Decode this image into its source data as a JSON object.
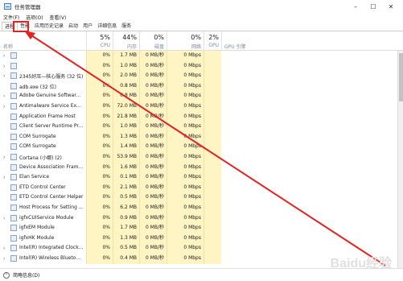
{
  "window": {
    "title": "任务管理器",
    "min": "–",
    "max": "☐",
    "close": "✕"
  },
  "menu": [
    "文件(F)",
    "选项(O)",
    "查看(V)"
  ],
  "tabs": [
    "进程",
    "性能",
    "应用历史记录",
    "启动",
    "用户",
    "详细信息",
    "服务"
  ],
  "columns": {
    "name": "名称",
    "cpu": {
      "pct": "5%",
      "label": "CPU"
    },
    "mem": {
      "pct": "44%",
      "label": "内存"
    },
    "disk": {
      "pct": "0%",
      "label": "磁盘"
    },
    "net": {
      "pct": "0%",
      "label": "网络"
    },
    "gpu": {
      "pct": "2%",
      "label": "GPU"
    },
    "gpu_engine": {
      "label": "GPU 引擎"
    }
  },
  "rows": [
    {
      "name": "",
      "cpu": "0%",
      "mem": "1.7 MB",
      "disk": "0 MB/秒",
      "net": "0 Mbps",
      "expand": true
    },
    {
      "name": "",
      "cpu": "0%",
      "mem": "1.0 MB",
      "disk": "0 MB/秒",
      "net": "0 Mbps",
      "expand": true
    },
    {
      "name": "2345好压—核心服务 (32 位)",
      "cpu": "0%",
      "mem": "2.0 MB",
      "disk": "0 MB/秒",
      "net": "0 Mbps",
      "expand": true
    },
    {
      "name": "adb.exe (32 位)",
      "cpu": "0%",
      "mem": "0.8 MB",
      "disk": "0 MB/秒",
      "net": "0 Mbps",
      "expand": false
    },
    {
      "name": "Adobe Genuine Software Int...",
      "cpu": "0%",
      "mem": "0.8 MB",
      "disk": "0 MB/秒",
      "net": "0 Mbps",
      "expand": true
    },
    {
      "name": "Antimalware Service Executa...",
      "cpu": "0%",
      "mem": "72.0 MB",
      "disk": "0 MB/秒",
      "net": "0 Mbps",
      "expand": true
    },
    {
      "name": "Application Frame Host",
      "cpu": "0%",
      "mem": "21.8 MB",
      "disk": "0 MB/秒",
      "net": "0 Mbps",
      "expand": false
    },
    {
      "name": "Client Server Runtime Process",
      "cpu": "0%",
      "mem": "1.0 MB",
      "disk": "0 MB/秒",
      "net": "0 Mbps",
      "expand": false
    },
    {
      "name": "COM Surrogate",
      "cpu": "0%",
      "mem": "1.3 MB",
      "disk": "0 MB/秒",
      "net": "0 Mbps",
      "expand": false
    },
    {
      "name": "COM Surrogate",
      "cpu": "0%",
      "mem": "1.4 MB",
      "disk": "0 MB/秒",
      "net": "0 Mbps",
      "expand": false
    },
    {
      "name": "Cortana (小娜) (2)",
      "cpu": "0%",
      "mem": "53.9 MB",
      "disk": "0 MB/秒",
      "net": "0 Mbps",
      "expand": true
    },
    {
      "name": "Device Association Framewo...",
      "cpu": "0%",
      "mem": "1.6 MB",
      "disk": "0 MB/秒",
      "net": "0 Mbps",
      "expand": false
    },
    {
      "name": "Elan Service",
      "cpu": "0%",
      "mem": "0.1 MB",
      "disk": "0 MB/秒",
      "net": "0 Mbps",
      "expand": true
    },
    {
      "name": "ETD Control Center",
      "cpu": "0%",
      "mem": "2.1 MB",
      "disk": "0 MB/秒",
      "net": "0 Mbps",
      "expand": false
    },
    {
      "name": "ETD Control Center Helper",
      "cpu": "0%",
      "mem": "0.5 MB",
      "disk": "0 MB/秒",
      "net": "0 Mbps",
      "expand": false
    },
    {
      "name": "Host Process for Setting Syn...",
      "cpu": "0%",
      "mem": "6.2 MB",
      "disk": "0 MB/秒",
      "net": "0 Mbps",
      "expand": false
    },
    {
      "name": "igfxCUIService Module",
      "cpu": "0%",
      "mem": "0.9 MB",
      "disk": "0 MB/秒",
      "net": "0 Mbps",
      "expand": true
    },
    {
      "name": "igfxEM Module",
      "cpu": "0%",
      "mem": "1.7 MB",
      "disk": "0 MB/秒",
      "net": "0 Mbps",
      "expand": false
    },
    {
      "name": "igfxHK Module",
      "cpu": "0%",
      "mem": "1.3 MB",
      "disk": "0 MB/秒",
      "net": "0 Mbps",
      "expand": false
    },
    {
      "name": "Intel(R) Integrated Clock Co...",
      "cpu": "0%",
      "mem": "0.5 MB",
      "disk": "0 MB/秒",
      "net": "0 Mbps",
      "expand": true
    },
    {
      "name": "Intel(R) Wireless Bluetooth(R)...",
      "cpu": "0%",
      "mem": "0.4 MB",
      "disk": "0 MB/秒",
      "net": "0 Mbps",
      "expand": true
    }
  ],
  "footer": {
    "label": "简略信息(D)"
  },
  "watermark": "Baidu经验",
  "colors": {
    "highlight": "#e32222",
    "usage_bg": "#fff4c4"
  }
}
